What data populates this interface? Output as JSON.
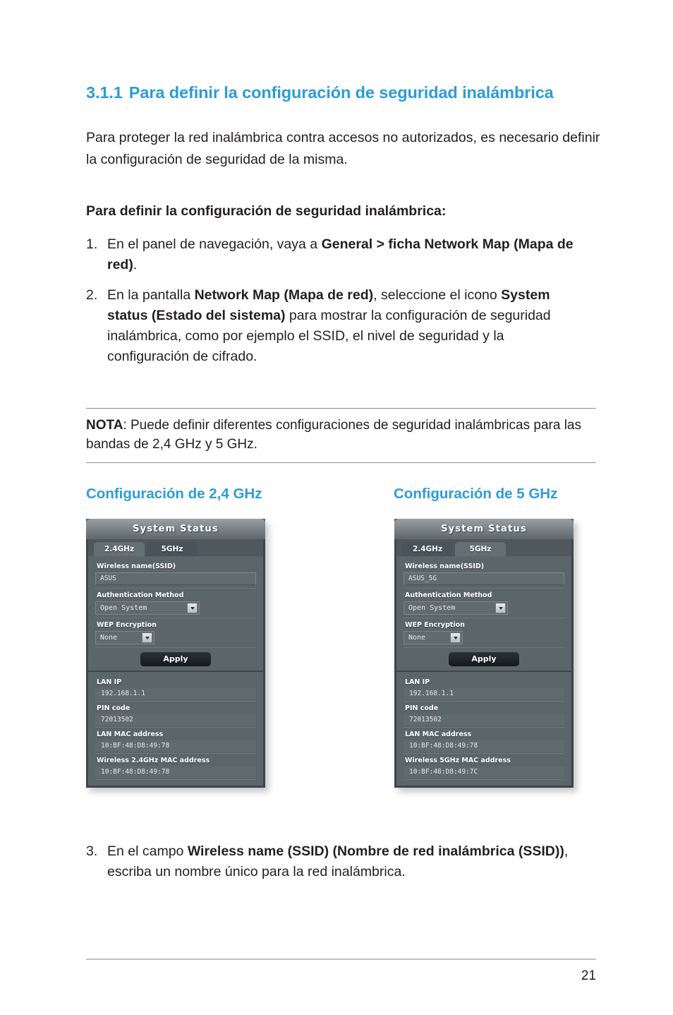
{
  "document": {
    "section_number": "3.1.1",
    "section_title": "Para definir la configuración de seguridad inalámbrica",
    "intro": "Para proteger la red inalámbrica contra accesos no autorizados, es necesario definir la configuración de seguridad de la misma.",
    "lead_in": "Para definir la configuración de seguridad inalámbrica:",
    "page_number": "21",
    "accent_color": "#2e9bd6"
  },
  "steps": [
    {
      "number": "1.",
      "parts": [
        {
          "text": "En el panel de navegación, vaya a ",
          "bold": false
        },
        {
          "text": "General > ficha Network Map (Mapa de red)",
          "bold": true
        },
        {
          "text": ".",
          "bold": false
        }
      ]
    },
    {
      "number": "2.",
      "parts": [
        {
          "text": "En la pantalla ",
          "bold": false
        },
        {
          "text": "Network Map (Mapa de red)",
          "bold": true
        },
        {
          "text": ", seleccione el icono ",
          "bold": false
        },
        {
          "text": "System status (Estado del sistema)",
          "bold": true
        },
        {
          "text": " para mostrar la configuración de seguridad inalámbrica, como por ejemplo el SSID, el nivel de seguridad y la configuración de cifrado.",
          "bold": false
        }
      ]
    }
  ],
  "note": {
    "label": "NOTA",
    "separator": ": ",
    "text": "Puede definir diferentes configuraciones de seguridad inalámbricas para las bandas de 2,4 GHz y 5 GHz."
  },
  "captions": {
    "left": "Configuración de 2,4 GHz",
    "right": "Configuración de 5 GHz"
  },
  "panels": {
    "left": {
      "title": "System Status",
      "tabs": [
        {
          "label": "2.4GHz",
          "active": true
        },
        {
          "label": "5GHz",
          "active": false
        }
      ],
      "fields": {
        "ssid_label": "Wireless name(SSID)",
        "ssid_value": "ASUS",
        "auth_label": "Authentication Method",
        "auth_value": "Open System",
        "wep_label": "WEP Encryption",
        "wep_value": "None",
        "apply_label": "Apply"
      },
      "info": [
        {
          "label": "LAN IP",
          "value": "192.168.1.1"
        },
        {
          "label": "PIN code",
          "value": "72013502"
        },
        {
          "label": "LAN MAC address",
          "value": "10:BF:48:D8:49:78"
        },
        {
          "label": "Wireless 2.4GHz MAC address",
          "value": "10:BF:48:D8:49:78"
        }
      ]
    },
    "right": {
      "title": "System Status",
      "tabs": [
        {
          "label": "2.4GHz",
          "active": false
        },
        {
          "label": "5GHz",
          "active": true
        }
      ],
      "fields": {
        "ssid_label": "Wireless name(SSID)",
        "ssid_value": "ASUS_5G",
        "auth_label": "Authentication Method",
        "auth_value": "Open System",
        "wep_label": "WEP Encryption",
        "wep_value": "None",
        "apply_label": "Apply"
      },
      "info": [
        {
          "label": "LAN IP",
          "value": "192.168.1.1"
        },
        {
          "label": "PIN code",
          "value": "72013502"
        },
        {
          "label": "LAN MAC address",
          "value": "10:BF:48:D8:49:78"
        },
        {
          "label": "Wireless 5GHz MAC address",
          "value": "10:BF:48:D8:49:7C"
        }
      ]
    }
  },
  "final_step": {
    "number": "3.",
    "parts": [
      {
        "text": "En el campo ",
        "bold": false
      },
      {
        "text": "Wireless name (SSID) (Nombre de red inalámbrica (SSID))",
        "bold": true
      },
      {
        "text": ", escriba un nombre único para la red inalámbrica.",
        "bold": false
      }
    ]
  }
}
